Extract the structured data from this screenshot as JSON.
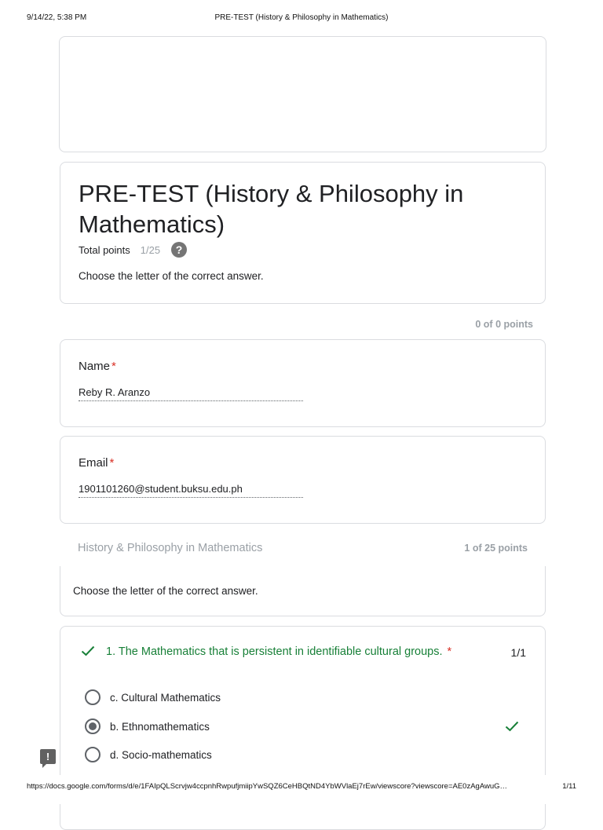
{
  "print_header": {
    "datetime": "9/14/22, 5:38 PM",
    "title": "PRE-TEST (History & Philosophy in Mathematics)"
  },
  "form": {
    "title": "PRE-TEST (History & Philosophy in Mathematics)",
    "total_points_label": "Total points",
    "total_points_value": "1/25",
    "help_icon": "?",
    "description": "Choose the letter of the correct answer."
  },
  "respondent_points": "0 of 0 points",
  "fields": {
    "name": {
      "label": "Name",
      "required_mark": "*",
      "value": "Reby R. Aranzo"
    },
    "email": {
      "label": "Email",
      "required_mark": "*",
      "value": "1901101260@student.buksu.edu.ph"
    }
  },
  "section": {
    "title": "History & Philosophy in Mathematics",
    "points": "1 of 25 points",
    "description": "Choose the letter of the correct answer."
  },
  "question": {
    "text": "1. The Mathematics that is persistent in identifiable cultural groups.",
    "required_mark": "*",
    "score": "1/1",
    "status_icon": "check-icon",
    "options": [
      {
        "label": "c. Cultural Mathematics",
        "selected": false
      },
      {
        "label": "b. Ethnomathematics",
        "selected": true,
        "correct": true
      },
      {
        "label": "d. Socio-mathematics",
        "selected": false
      }
    ]
  },
  "feedback_icon": "!",
  "print_footer": {
    "url": "https://docs.google.com/forms/d/e/1FAIpQLScrvjw4ccpnhRwpufjmiipYwSQZ6CeHBQtND4YbWVlaEj7rEw/viewscore?viewscore=AE0zAgAwuG…",
    "page": "1/11"
  },
  "colors": {
    "correct_green": "#188038",
    "required_red": "#d93025",
    "muted_gray": "#9aa0a6",
    "border": "#dadce0"
  }
}
